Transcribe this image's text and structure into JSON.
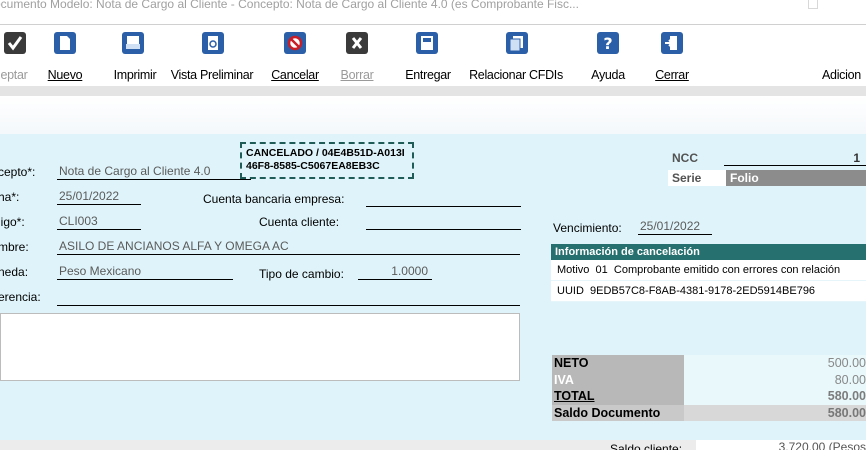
{
  "window": {
    "title": "ocumento Modelo: Nota de Cargo al Cliente - Concepto: Nota de Cargo al Cliente 4.0 (es Comprobante Fisc..."
  },
  "toolbar": {
    "accept_label": "eptar",
    "new_label": "Nuevo",
    "print_label": "Imprimir",
    "preview_label": "Vista Preliminar",
    "cancel_label": "Cancelar",
    "delete_label": "Borrar",
    "deliver_label": "Entregar",
    "relate_label": "Relacionar CFDIs",
    "help_label": "Ayuda",
    "close_label": "Cerrar",
    "extra_label": "Adicion"
  },
  "form": {
    "concept_label": "cepto*:",
    "concept_value": "Nota de Cargo al Cliente 4.0",
    "date_label": "ha*:",
    "date_value": "25/01/2022",
    "bank_label": "Cuenta bancaria empresa:",
    "code_label": "ligo*:",
    "code_value": "CLI003",
    "client_account_label": "Cuenta cliente:",
    "name_label": "mbre:",
    "name_value": "ASILO DE ANCIANOS ALFA Y OMEGA AC",
    "currency_label": "neda:",
    "currency_value": "Peso Mexicano",
    "exchange_label": "Tipo de cambio:",
    "exchange_value": "1.0000",
    "reference_label": "erencia:"
  },
  "cancel_stamp": {
    "status": "CANCELADO",
    "uuid_line1": " / 04E4B51D-A013I",
    "uuid_line2": "46F8-8585-C5067EA8EB3C"
  },
  "document": {
    "ncc_label": "NCC",
    "number": "1",
    "serie_label": "Serie",
    "folio_label": "Folio",
    "due_label": "Vencimiento:",
    "due_value": "25/01/2022"
  },
  "cancellation_info": {
    "header": "Información de cancelación",
    "motive_label": "Motivo",
    "motive_code": "01",
    "motive_text": "Comprobante emitido con errores con relación",
    "uuid_label": "UUID",
    "uuid_value": "9EDB57C8-F8AB-4381-9178-2ED5914BE796"
  },
  "totals": {
    "net_label": "NETO",
    "net_value": "500.00",
    "vat_label": "IVA",
    "vat_value": "80.00",
    "total_label": "TOTAL",
    "total_value": "580.00",
    "balance_label": "Saldo Documento",
    "balance_value": "580.00"
  },
  "footer": {
    "client_balance_label": "Saldo cliente:",
    "client_balance_value": "3,720.00  (Pesos"
  },
  "colors": {
    "form_bg": "#dff4fa",
    "cancel_header": "#26706f",
    "icon_blue": "#2b5fa8",
    "icon_dark": "#3a3a3a",
    "icon_red": "#c81e28"
  },
  "icons": [
    "check-icon",
    "new-document-icon",
    "printer-icon",
    "preview-icon",
    "cancel-icon",
    "delete-icon",
    "deliver-icon",
    "relate-icon",
    "help-icon",
    "exit-icon"
  ]
}
